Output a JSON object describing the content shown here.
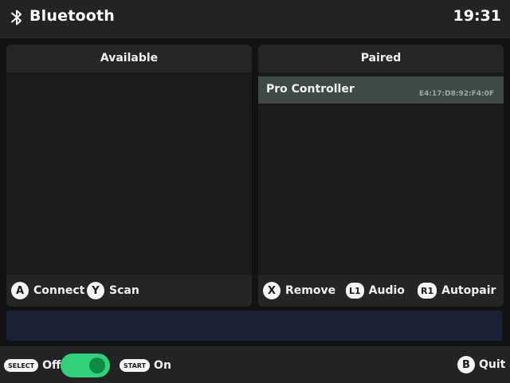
{
  "header": {
    "title": "Bluetooth",
    "clock": "19:31",
    "icon": "bluetooth-icon"
  },
  "available": {
    "title": "Available",
    "devices": [],
    "hints": [
      {
        "button": "A",
        "label": "Connect"
      },
      {
        "button": "Y",
        "label": "Scan"
      }
    ]
  },
  "paired": {
    "title": "Paired",
    "devices": [
      {
        "name": "Pro Controller",
        "mac": "E4:17:D8:92:F4:0F"
      }
    ],
    "hints": [
      {
        "button": "X",
        "label": "Remove"
      },
      {
        "button": "L1",
        "label": "Audio"
      },
      {
        "button": "R1",
        "label": "Autopair"
      }
    ]
  },
  "status": {
    "message": ""
  },
  "footer": {
    "select": {
      "button": "SELECT",
      "label": "Off"
    },
    "toggle": {
      "state": "on",
      "color": "#2fd27a"
    },
    "start": {
      "button": "START",
      "label": "On"
    },
    "quit": {
      "button": "B",
      "label": "Quit"
    }
  },
  "colors": {
    "selected_row": "#3d4a46",
    "status_bar": "#1a2134",
    "toggle_on": "#2fd27a"
  }
}
